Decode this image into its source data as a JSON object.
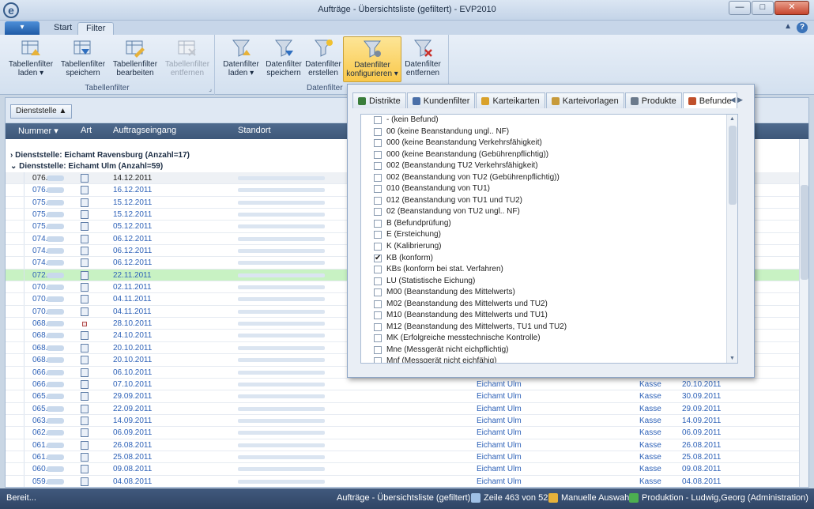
{
  "window": {
    "title": "Aufträge - Übersichtsliste (gefiltert) - EVP2010",
    "logo": "e",
    "min": "—",
    "max": "□",
    "close": "✕"
  },
  "ribbon_tabs": {
    "start": "Start",
    "filter": "Filter"
  },
  "ribbon": {
    "tabellenfilter": {
      "label": "Tabellenfilter",
      "buttons": [
        {
          "label": "Tabellenfilter laden ▾"
        },
        {
          "label": "Tabellenfilter speichern"
        },
        {
          "label": "Tabellenfilter bearbeiten"
        },
        {
          "label": "Tabellenfilter entfernen"
        }
      ]
    },
    "datenfilter": {
      "label": "Datenfilter",
      "buttons": [
        {
          "label": "Datenfilter laden ▾"
        },
        {
          "label": "Datenfilter speichern"
        },
        {
          "label": "Datenfilter erstellen"
        },
        {
          "label": "Datenfilter konfigurieren ▾"
        },
        {
          "label": "Datenfilter entfernen"
        }
      ]
    }
  },
  "grid": {
    "group_chip": "Dienststelle ▲",
    "columns": {
      "nummer": "Nummer ▾",
      "art": "Art",
      "auftragseingang": "Auftragseingang",
      "standort": "Standort"
    },
    "groups": [
      "› Dienststelle: Eichamt Ravensburg (Anzahl=17)",
      "⌄ Dienststelle: Eichamt Ulm (Anzahl=59)"
    ],
    "rows": [
      {
        "num": "076.",
        "date": "14.12.2011",
        "dst": "",
        "kasse": "",
        "date2": ""
      },
      {
        "num": "076.",
        "date": "16.12.2011",
        "dst": "",
        "kasse": "",
        "date2": ""
      },
      {
        "num": "075.",
        "date": "15.12.2011",
        "dst": "",
        "kasse": "",
        "date2": ""
      },
      {
        "num": "075.",
        "date": "15.12.2011",
        "dst": "",
        "kasse": "",
        "date2": ""
      },
      {
        "num": "075.",
        "date": "05.12.2011",
        "dst": "",
        "kasse": "",
        "date2": ""
      },
      {
        "num": "074.",
        "date": "06.12.2011",
        "dst": "",
        "kasse": "",
        "date2": ""
      },
      {
        "num": "074.",
        "date": "06.12.2011",
        "dst": "",
        "kasse": "",
        "date2": ""
      },
      {
        "num": "074.",
        "date": "06.12.2011",
        "dst": "",
        "kasse": "",
        "date2": ""
      },
      {
        "num": "072.",
        "date": "22.11.2011",
        "dst": "",
        "kasse": "",
        "date2": ""
      },
      {
        "num": "070.",
        "date": "02.11.2011",
        "dst": "",
        "kasse": "",
        "date2": ""
      },
      {
        "num": "070.",
        "date": "04.11.2011",
        "dst": "",
        "kasse": "",
        "date2": ""
      },
      {
        "num": "070.",
        "date": "04.11.2011",
        "dst": "",
        "kasse": "",
        "date2": ""
      },
      {
        "num": "068.",
        "date": "28.10.2011",
        "dst": "",
        "kasse": "",
        "date2": ""
      },
      {
        "num": "068.",
        "date": "24.10.2011",
        "dst": "",
        "kasse": "",
        "date2": ""
      },
      {
        "num": "068.",
        "date": "20.10.2011",
        "dst": "",
        "kasse": "",
        "date2": ""
      },
      {
        "num": "068.",
        "date": "20.10.2011",
        "dst": "",
        "kasse": "",
        "date2": ""
      },
      {
        "num": "066.",
        "date": "06.10.2011",
        "dst": "",
        "kasse": "",
        "date2": ""
      },
      {
        "num": "066.",
        "date": "07.10.2011",
        "dst": "Eichamt Ulm",
        "kasse": "Kasse",
        "date2": "20.10.2011"
      },
      {
        "num": "065.",
        "date": "29.09.2011",
        "dst": "Eichamt Ulm",
        "kasse": "Kasse",
        "date2": "30.09.2011"
      },
      {
        "num": "065.",
        "date": "22.09.2011",
        "dst": "Eichamt Ulm",
        "kasse": "Kasse",
        "date2": "29.09.2011"
      },
      {
        "num": "063.",
        "date": "14.09.2011",
        "dst": "Eichamt Ulm",
        "kasse": "Kasse",
        "date2": "14.09.2011"
      },
      {
        "num": "062.",
        "date": "06.09.2011",
        "dst": "Eichamt Ulm",
        "kasse": "Kasse",
        "date2": "06.09.2011"
      },
      {
        "num": "061.",
        "date": "26.08.2011",
        "dst": "Eichamt Ulm",
        "kasse": "Kasse",
        "date2": "26.08.2011"
      },
      {
        "num": "061.",
        "date": "25.08.2011",
        "dst": "Eichamt Ulm",
        "kasse": "Kasse",
        "date2": "25.08.2011"
      },
      {
        "num": "060.",
        "date": "09.08.2011",
        "dst": "Eichamt Ulm",
        "kasse": "Kasse",
        "date2": "09.08.2011"
      },
      {
        "num": "059.",
        "date": "04.08.2011",
        "dst": "Eichamt Ulm",
        "kasse": "Kasse",
        "date2": "04.08.2011"
      }
    ]
  },
  "popup": {
    "tabs": [
      {
        "label": "Distrikte",
        "color": "#3a7d3a"
      },
      {
        "label": "Kundenfilter",
        "color": "#4a6fa8"
      },
      {
        "label": "Karteikarten",
        "color": "#d9a12a"
      },
      {
        "label": "Karteivorlagen",
        "color": "#c79a3a"
      },
      {
        "label": "Produkte",
        "color": "#6b7a8c"
      },
      {
        "label": "Befunde",
        "color": "#c0502b"
      }
    ],
    "nav": "◀  ▶",
    "items": [
      {
        "label": "- (kein Befund)",
        "checked": false
      },
      {
        "label": "00 (keine Beanstandung ungl.. NF)",
        "checked": false
      },
      {
        "label": "000 (keine Beanstandung Verkehrsfähigkeit)",
        "checked": false
      },
      {
        "label": "000 (keine Beanstandung (Gebührenpflichtig))",
        "checked": false
      },
      {
        "label": "002 (Beanstandung TU2 Verkehrsfähigkeit)",
        "checked": false
      },
      {
        "label": "002 (Beanstandung von TU2 (Gebührenpflichtig))",
        "checked": false
      },
      {
        "label": "010 (Beanstandung von TU1)",
        "checked": false
      },
      {
        "label": "012 (Beanstandung von TU1 und TU2)",
        "checked": false
      },
      {
        "label": "02 (Beanstandung von TU2 ungl.. NF)",
        "checked": false
      },
      {
        "label": "B (Befundprüfung)",
        "checked": false
      },
      {
        "label": "E (Ersteichung)",
        "checked": false
      },
      {
        "label": "K (Kalibrierung)",
        "checked": false
      },
      {
        "label": "KB (konform)",
        "checked": true
      },
      {
        "label": "KBs (konform bei stat. Verfahren)",
        "checked": false
      },
      {
        "label": "LU (Statistische Eichung)",
        "checked": false
      },
      {
        "label": "M00 (Beanstandung des Mittelwerts)",
        "checked": false
      },
      {
        "label": "M02 (Beanstandung des Mittelwerts und TU2)",
        "checked": false
      },
      {
        "label": "M10 (Beanstandung des Mittelwerts und TU1)",
        "checked": false
      },
      {
        "label": "M12 (Beanstandung des Mittelwerts, TU1 und TU2)",
        "checked": false
      },
      {
        "label": "MK (Erfolgreiche messtechnische Kontrolle)",
        "checked": false
      },
      {
        "label": "Mne (Messgerät nicht eichpflichtig)",
        "checked": false
      },
      {
        "label": "Mnf (Messgerät nicht eichfähig)",
        "checked": false
      }
    ]
  },
  "status": {
    "left": "Bereit...",
    "view": "Aufträge - Übersichtsliste (gefiltert)",
    "row_info": "Zeile 463 von 523",
    "selection": "Manuelle Auswahl",
    "user": "Produktion - Ludwig,Georg (Administration)"
  }
}
